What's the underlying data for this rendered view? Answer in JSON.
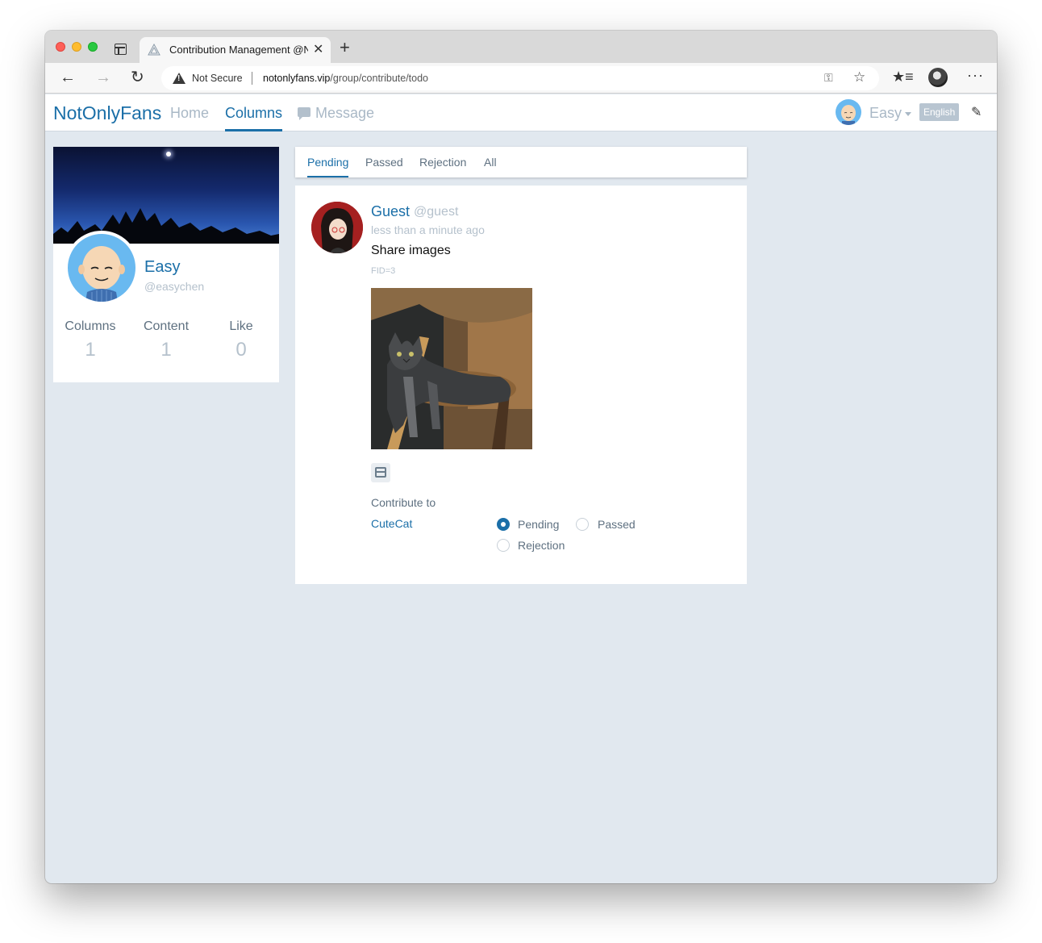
{
  "browser": {
    "tab_title": "Contribution Management @NotOnlyFans",
    "new_tab_label": "+",
    "close_tab_label": "✕",
    "security_label": "Not Secure",
    "url_host": "notonlyfans.vip",
    "url_path": "/group/contribute/todo",
    "more_label": "···"
  },
  "site": {
    "brand": "NotOnlyFans",
    "nav": {
      "home": "Home",
      "columns": "Columns",
      "message": "Message"
    },
    "user": {
      "name": "Easy",
      "language": "English"
    }
  },
  "profile": {
    "name": "Easy",
    "handle": "@easychen",
    "stats": [
      {
        "label": "Columns",
        "value": "1"
      },
      {
        "label": "Content",
        "value": "1"
      },
      {
        "label": "Like",
        "value": "0"
      }
    ]
  },
  "tabs": [
    "Pending",
    "Passed",
    "Rejection",
    "All"
  ],
  "post": {
    "author": "Guest",
    "handle": "@guest",
    "time": "less than a minute ago",
    "text": "Share images",
    "fid": "FID=3",
    "contribute_label": "Contribute to",
    "group": "CuteCat",
    "options": [
      "Pending",
      "Passed",
      "Rejection"
    ],
    "selected_option": "Pending"
  },
  "colors": {
    "accent": "#1b6fa8",
    "muted": "#b5c1cc",
    "page_background": "#e1e8ef"
  },
  "icons": [
    "tabs-icon",
    "favicon-icon",
    "back-icon",
    "forward-icon",
    "reload-icon",
    "warning-icon",
    "key-icon",
    "add-favorite-icon",
    "favorites-icon",
    "profile-icon",
    "more-icon",
    "message-icon",
    "caret-down-icon",
    "edit-icon",
    "archive-box-icon"
  ]
}
